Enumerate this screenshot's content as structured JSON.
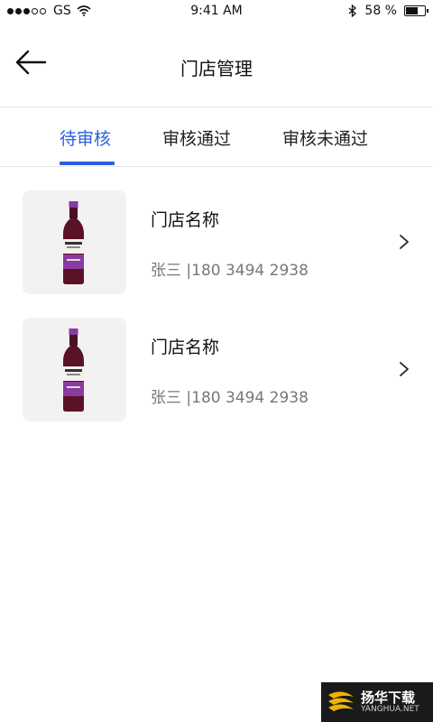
{
  "status_bar": {
    "carrier": "GS",
    "time": "9:41 AM",
    "battery_percent": "58 %",
    "battery_level": 0.58
  },
  "header": {
    "title": "门店管理"
  },
  "tabs": [
    {
      "label": "待审核",
      "active": true
    },
    {
      "label": "审核通过",
      "active": false
    },
    {
      "label": "审核未通过",
      "active": false
    }
  ],
  "stores": [
    {
      "name": "门店名称",
      "contact": "张三 |180 3494 2938"
    },
    {
      "name": "门店名称",
      "contact": "张三 |180 3494 2938"
    }
  ],
  "colors": {
    "accent": "#2b5fe0",
    "wine_bottle": "#5a1226",
    "wine_label": "#8a3aa0"
  },
  "watermark": {
    "name": "扬华下载",
    "url": "YANGHUA.NET"
  }
}
